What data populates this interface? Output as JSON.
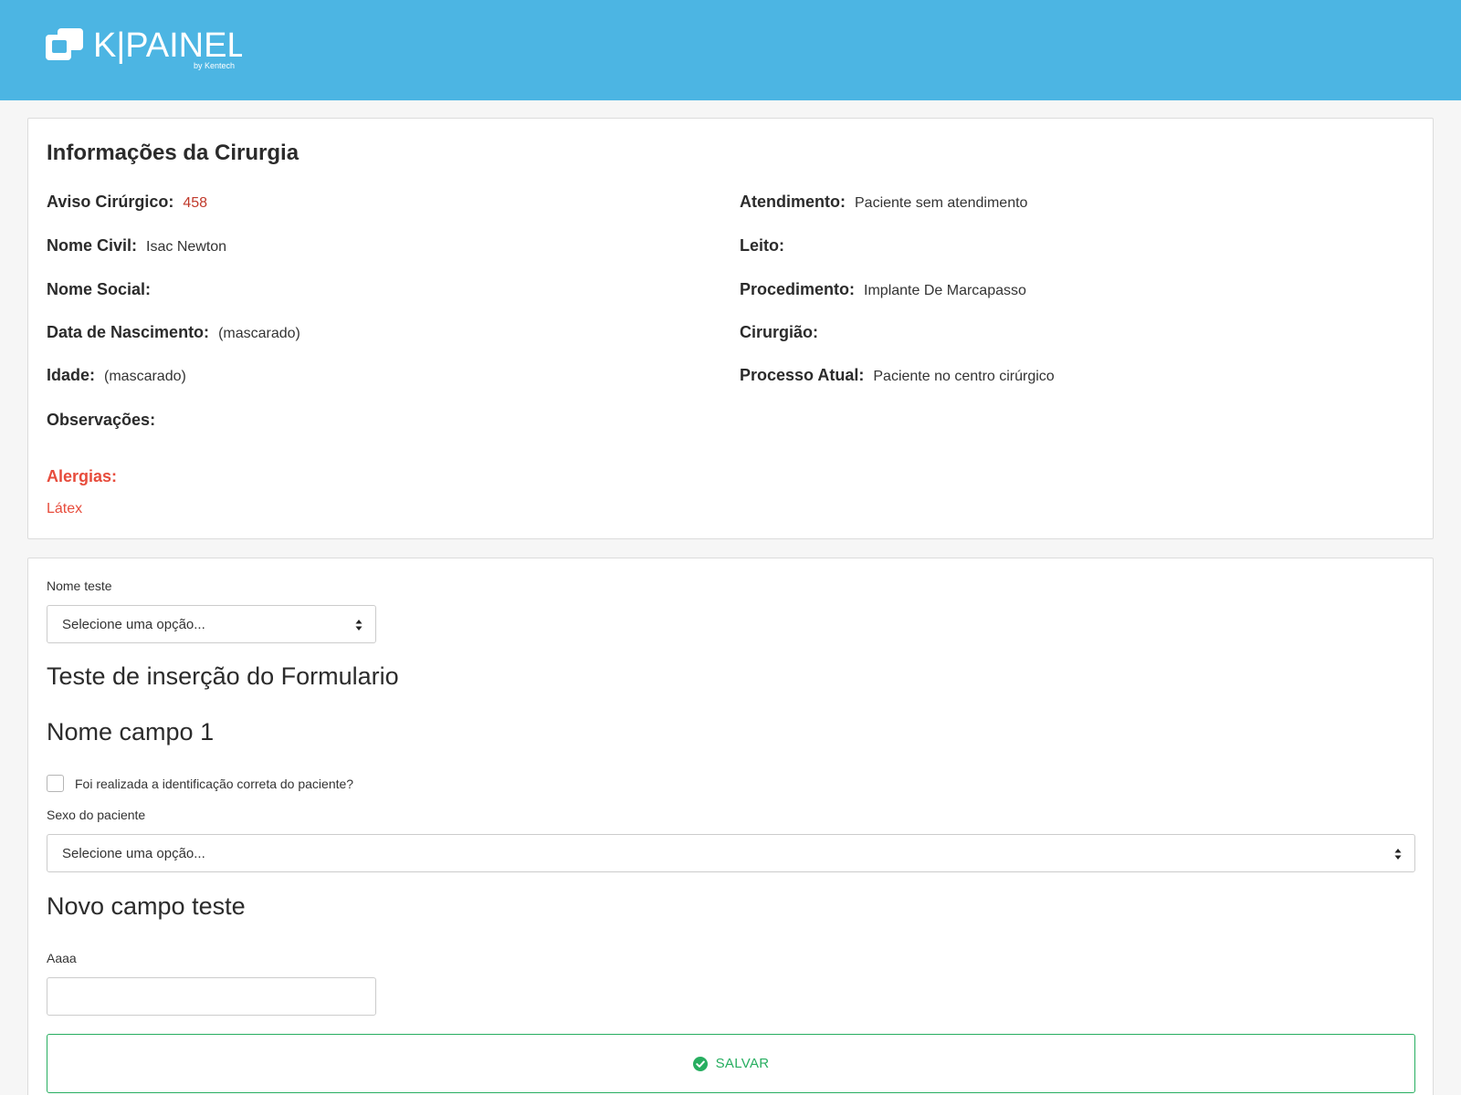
{
  "header": {
    "logo_text": "K|PAINEL",
    "logo_sub": "by Kentech"
  },
  "surgery_info": {
    "title": "Informações da Cirurgia",
    "left": [
      {
        "label": "Aviso Cirúrgico:",
        "value": "458"
      },
      {
        "label": "Nome Civil:",
        "value": "Isac Newton"
      },
      {
        "label": "Nome Social:",
        "value": ""
      },
      {
        "label": "Data de Nascimento:",
        "value": "(mascarado)"
      },
      {
        "label": "Idade:",
        "value": "(mascarado)"
      },
      {
        "label": "Observações:",
        "value": ""
      }
    ],
    "right": [
      {
        "label": "Atendimento:",
        "value": "Paciente sem atendimento"
      },
      {
        "label": "Leito:",
        "value": ""
      },
      {
        "label": "Procedimento:",
        "value": "Implante De Marcapasso"
      },
      {
        "label": "Cirurgião:",
        "value": ""
      },
      {
        "label": "Processo Atual:",
        "value": "Paciente no centro cirúrgico"
      }
    ],
    "allergies_title": "Alergias:",
    "allergies": [
      "Látex"
    ]
  },
  "form": {
    "nome_teste_label": "Nome teste",
    "nome_teste_select": "Selecione uma opção...",
    "section_title": "Teste de inserção do Formulario",
    "campo1_title": "Nome campo 1",
    "checkbox_label": "Foi realizada a identificação correta do paciente?",
    "checkbox_checked": false,
    "sexo_label": "Sexo do paciente",
    "sexo_select": "Selecione uma opção...",
    "novo_campo_title": "Novo campo teste",
    "aaaa_label": "Aaaa",
    "aaaa_value": "",
    "save_label": "SALVAR"
  },
  "colors": {
    "header": "#4cb5e3",
    "alert": "#e74c3c",
    "success": "#27ae60"
  }
}
